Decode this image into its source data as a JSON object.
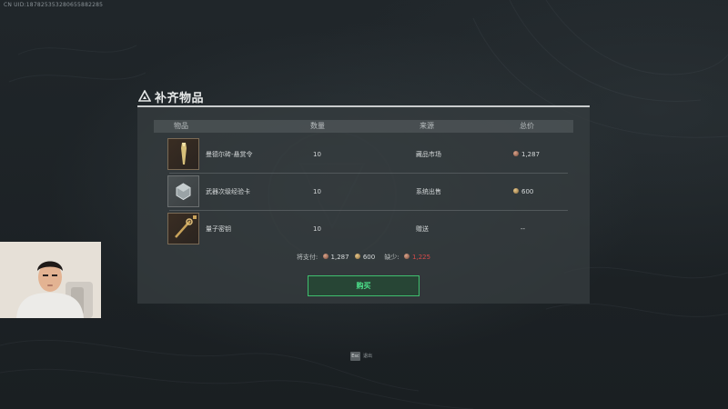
{
  "uid": "CN UID:187825353280655882285",
  "dialog": {
    "title": "补齐物品",
    "headers": {
      "item": "物品",
      "quantity": "数量",
      "source": "来源",
      "total": "总价"
    },
    "rows": [
      {
        "name": "曼德尔砖-悬赏令",
        "quantity": "10",
        "source": "藏品市场",
        "price": "1,287",
        "icon": "golden-bullet-icon",
        "coin": "copper"
      },
      {
        "name": "武器次级经验卡",
        "quantity": "10",
        "source": "系统出售",
        "price": "600",
        "icon": "hexagon-card-icon",
        "coin": "gold"
      },
      {
        "name": "量子密钥",
        "quantity": "10",
        "source": "赠送",
        "price": "--",
        "icon": "quantum-key-icon",
        "coin": ""
      }
    ],
    "summary": {
      "pay_label": "将支付:",
      "pay_copper": "1,287",
      "pay_gold": "600",
      "short_label": "缺少:",
      "short_value": "1,225"
    },
    "buy_label": "购买"
  },
  "footer": {
    "esc_key": "Esc",
    "esc_label": "退出"
  },
  "colors": {
    "accent_green": "#4de08a",
    "shortage_red": "#d64a4a",
    "background": "#1c2124"
  }
}
